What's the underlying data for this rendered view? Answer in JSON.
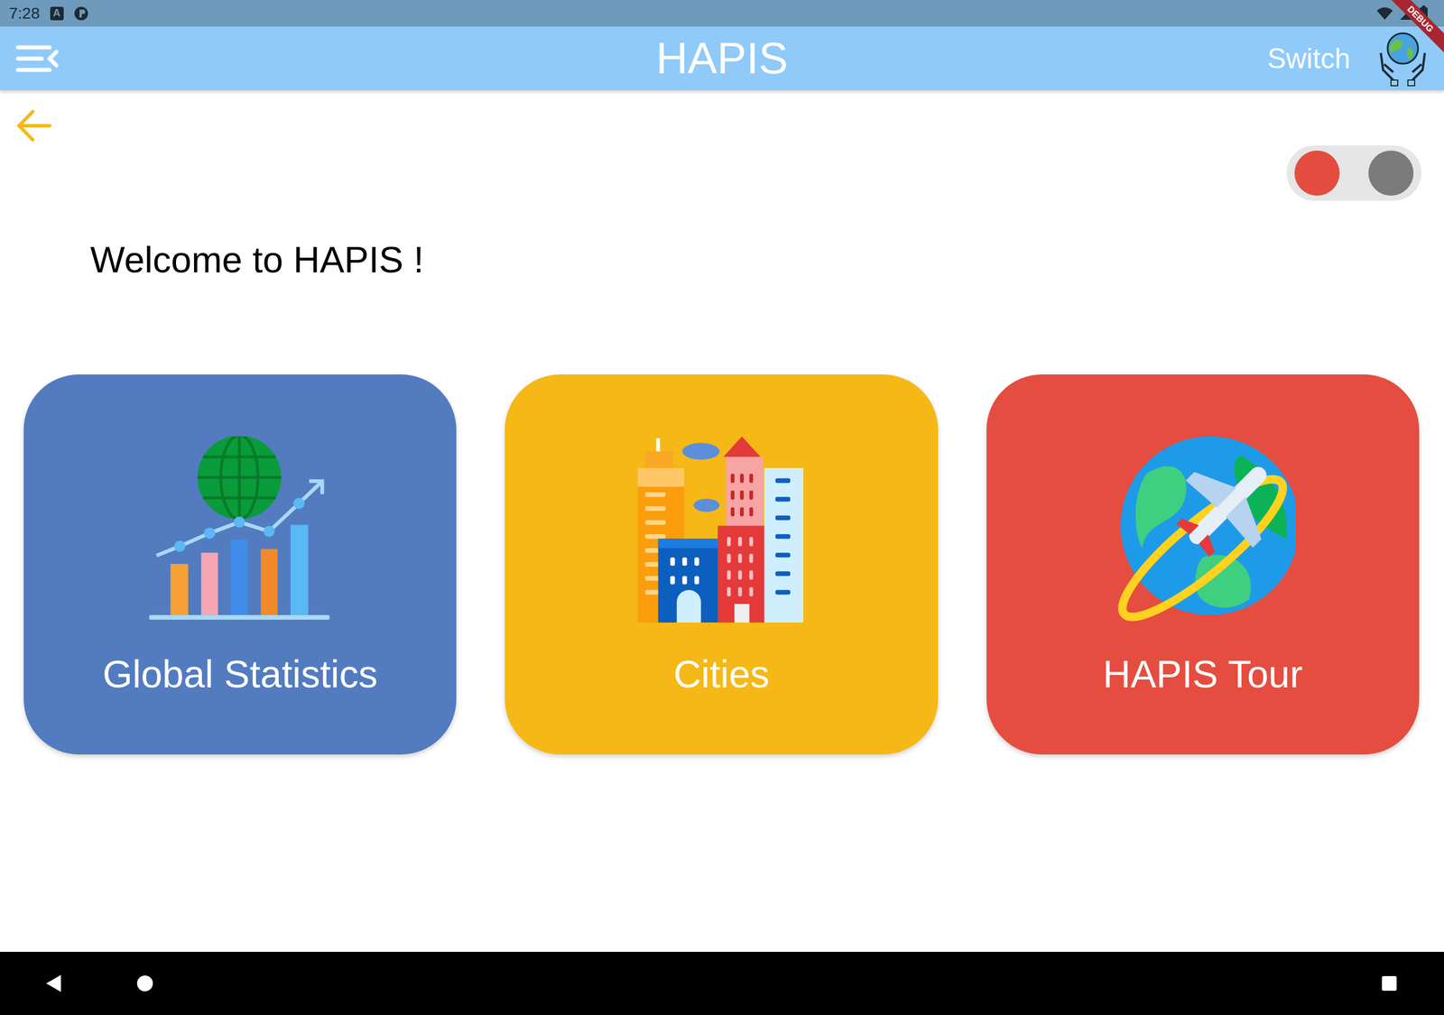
{
  "status_bar": {
    "time": "7:28",
    "notification_badge": "A"
  },
  "debug_banner": "DEBUG",
  "app_bar": {
    "title": "HAPIS",
    "switch_label": "Switch"
  },
  "toggle": {
    "dots": [
      {
        "color": "#e44c3f"
      },
      {
        "color": "#7b7b7b"
      }
    ]
  },
  "welcome": "Welcome to HAPIS !",
  "cards": [
    {
      "title": "Global Statistics",
      "color": "#537bc0",
      "kind": "statistics"
    },
    {
      "title": "Cities",
      "color": "#f5b816",
      "kind": "cities"
    },
    {
      "title": "HAPIS Tour",
      "color": "#e54d40",
      "kind": "tour"
    }
  ]
}
